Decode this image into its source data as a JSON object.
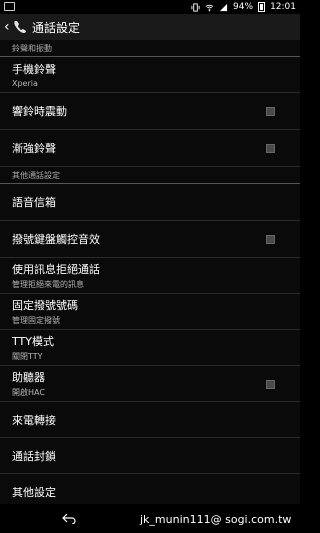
{
  "status_bar": {
    "battery": "94%",
    "time": "12:01"
  },
  "action_bar": {
    "title": "通話設定"
  },
  "sections": {
    "ringtone_header": "鈴聲和振動",
    "other_header": "其他通話設定"
  },
  "items": {
    "ringtone": {
      "title": "手機鈴聲",
      "subtitle": "Xperia"
    },
    "vibrate": {
      "title": "響鈴時震動"
    },
    "ascending": {
      "title": "漸強鈴聲"
    },
    "voicemail": {
      "title": "語音信箱"
    },
    "dialpad_tones": {
      "title": "撥號鍵盤觸控音效"
    },
    "reject_sms": {
      "title": "使用訊息拒絕通話",
      "subtitle": "管理拒絕來電的訊息"
    },
    "fdn": {
      "title": "固定撥號號碼",
      "subtitle": "管理固定撥號"
    },
    "tty": {
      "title": "TTY模式",
      "subtitle": "關閉TTY"
    },
    "hac": {
      "title": "助聽器",
      "subtitle": "開啟HAC"
    },
    "forwarding": {
      "title": "來電轉接"
    },
    "barring": {
      "title": "通話封鎖"
    },
    "additional": {
      "title": "其他設定"
    }
  },
  "watermark": "jk_munin111@ sogi.com.tw"
}
